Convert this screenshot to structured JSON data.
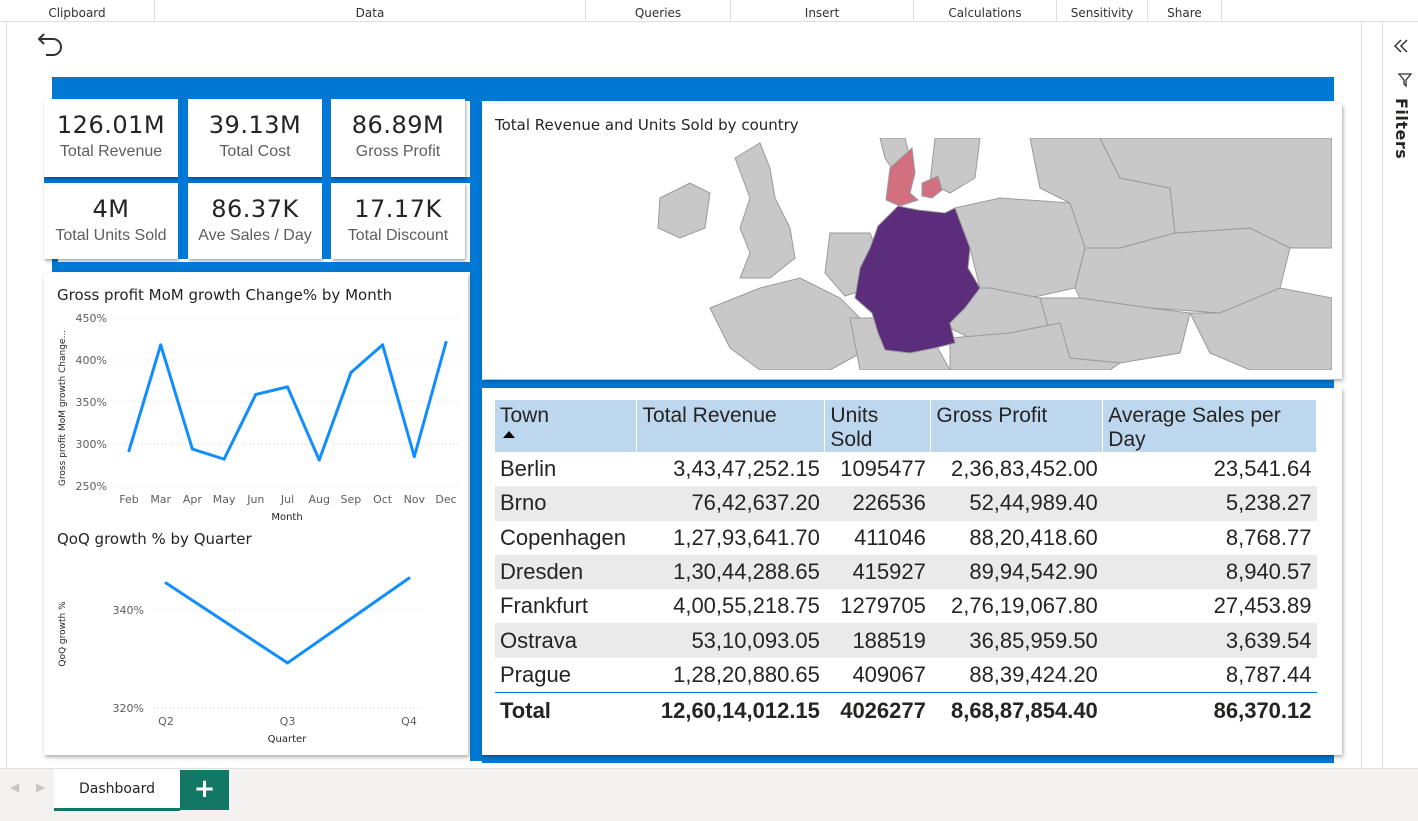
{
  "ribbon": {
    "groups": [
      "Clipboard",
      "Data",
      "Queries",
      "Insert",
      "Calculations",
      "Sensitivity",
      "Share"
    ]
  },
  "kpis": [
    {
      "value": "126.01M",
      "label": "Total Revenue"
    },
    {
      "value": "39.13M",
      "label": "Total Cost"
    },
    {
      "value": "86.89M",
      "label": "Gross Profit"
    },
    {
      "value": "4M",
      "label": "Total Units Sold"
    },
    {
      "value": "86.37K",
      "label": "Ave Sales / Day"
    },
    {
      "value": "17.17K",
      "label": "Total Discount"
    }
  ],
  "map": {
    "title": "Total Revenue and Units Sold by country",
    "highlight_colors": {
      "germany": "#5c2d7a",
      "denmark": "#d2707f",
      "other": "#c8c8c8"
    }
  },
  "chart_data": [
    {
      "type": "line",
      "title": "Gross profit MoM growth Change% by Month",
      "xlabel": "Month",
      "ylabel": "Gross profit MoM growth Change...",
      "categories": [
        "Feb",
        "Mar",
        "Apr",
        "May",
        "Jun",
        "Jul",
        "Aug",
        "Sep",
        "Oct",
        "Nov",
        "Dec"
      ],
      "values": [
        292,
        418,
        294,
        282,
        359,
        368,
        281,
        385,
        418,
        285,
        421
      ],
      "ylim": [
        250,
        450
      ],
      "yticks": [
        "250%",
        "300%",
        "350%",
        "400%",
        "450%"
      ],
      "color": "#118dff",
      "grid": true
    },
    {
      "type": "line",
      "title": "QoQ growth % by Quarter",
      "xlabel": "Quarter",
      "ylabel": "QoQ growth %",
      "categories": [
        "Q2",
        "Q3",
        "Q4"
      ],
      "values": [
        345.5,
        329.2,
        346.5
      ],
      "ylim": [
        320,
        350
      ],
      "yticks": [
        "320%",
        "340%"
      ],
      "color": "#118dff",
      "grid": true
    },
    {
      "type": "table",
      "columns": [
        "Town",
        "Total Revenue",
        "Units Sold",
        "Gross Profit",
        "Average Sales per Day"
      ],
      "rows": [
        [
          "Berlin",
          "3,43,47,252.15",
          "1095477",
          "2,36,83,452.00",
          "23,541.64"
        ],
        [
          "Brno",
          "76,42,637.20",
          "226536",
          "52,44,989.40",
          "5,238.27"
        ],
        [
          "Copenhagen",
          "1,27,93,641.70",
          "411046",
          "88,20,418.60",
          "8,768.77"
        ],
        [
          "Dresden",
          "1,30,44,288.65",
          "415927",
          "89,94,542.90",
          "8,940.57"
        ],
        [
          "Frankfurt",
          "4,00,55,218.75",
          "1279705",
          "2,76,19,067.80",
          "27,453.89"
        ],
        [
          "Ostrava",
          "53,10,093.05",
          "188519",
          "36,85,959.50",
          "3,639.54"
        ],
        [
          "Prague",
          "1,28,20,880.65",
          "409067",
          "88,39,424.20",
          "8,787.44"
        ]
      ],
      "total": [
        "Total",
        "12,60,14,012.15",
        "4026277",
        "8,68,87,854.40",
        "86,370.12"
      ]
    }
  ],
  "filters_pane": {
    "label": "Filters"
  },
  "tabs": {
    "active": "Dashboard",
    "add": "+"
  },
  "colors": {
    "accent": "#0078d4",
    "tab_accent": "#117865",
    "header_bg": "#bdd7ee"
  }
}
